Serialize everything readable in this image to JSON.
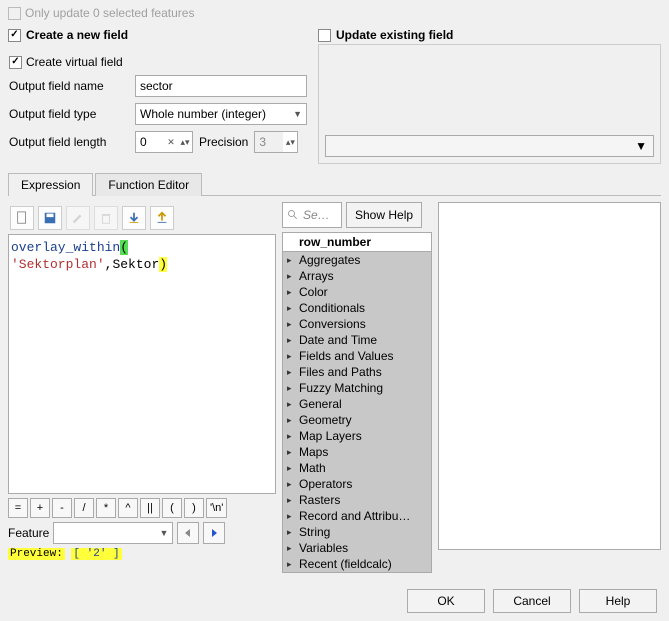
{
  "top_checkbox": {
    "label": "Only update 0 selected features",
    "checked": false,
    "disabled": true
  },
  "create_new": {
    "label": "Create a new field",
    "checked": true
  },
  "update_existing": {
    "label": "Update existing field",
    "checked": false
  },
  "virtual_field": {
    "label": "Create virtual field",
    "checked": true
  },
  "output_name": {
    "label": "Output field name",
    "value": "sector"
  },
  "output_type": {
    "label": "Output field type",
    "value": "Whole number (integer)"
  },
  "output_length": {
    "label": "Output field length",
    "value": "0"
  },
  "precision": {
    "label": "Precision",
    "value": "3"
  },
  "tabs": {
    "expression": "Expression",
    "function_editor": "Function Editor"
  },
  "expression": {
    "fn": "overlay_within",
    "open": "(",
    "str": "'Sektorplan'",
    "comma": ",",
    "arg": "Sektor",
    "close": ")"
  },
  "operators": [
    "=",
    "+",
    "-",
    "/",
    "*",
    "^",
    "||",
    "(",
    ")",
    "'\\n'"
  ],
  "feature_label": "Feature",
  "preview_label": "Preview:",
  "preview_value": "[ '2' ]",
  "search_placeholder": "Se…",
  "show_help": "Show Help",
  "funclist_header": "row_number",
  "funclist_items": [
    "Aggregates",
    "Arrays",
    "Color",
    "Conditionals",
    "Conversions",
    "Date and Time",
    "Fields and Values",
    "Files and Paths",
    "Fuzzy Matching",
    "General",
    "Geometry",
    "Map Layers",
    "Maps",
    "Math",
    "Operators",
    "Rasters",
    "Record and Attribu…",
    "String",
    "Variables",
    "Recent (fieldcalc)"
  ],
  "buttons": {
    "ok": "OK",
    "cancel": "Cancel",
    "help": "Help"
  }
}
